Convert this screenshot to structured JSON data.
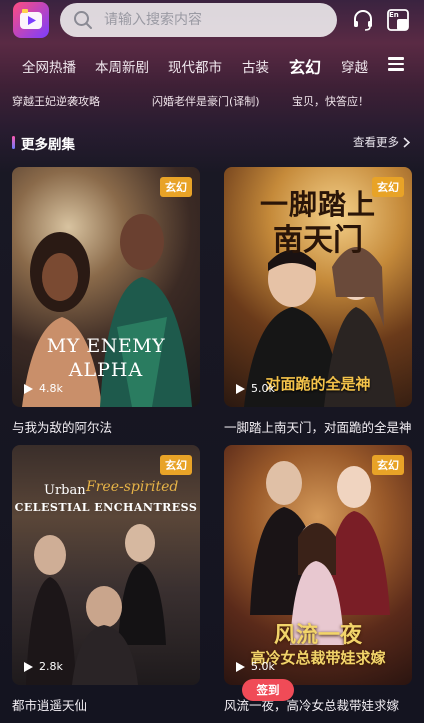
{
  "header": {
    "search_placeholder": "请输入搜索内容",
    "icons": [
      "app-logo-icon",
      "search-icon",
      "headset-icon",
      "translate-icon"
    ],
    "translate_badge": "En"
  },
  "nav": {
    "tabs": [
      {
        "label": "全网热播",
        "active": false
      },
      {
        "label": "本周新剧",
        "active": false
      },
      {
        "label": "现代都市",
        "active": false
      },
      {
        "label": "古装",
        "active": false
      },
      {
        "label": "玄幻",
        "active": true
      },
      {
        "label": "穿越",
        "active": false
      }
    ]
  },
  "ticker": {
    "items": [
      "穿越王妃逆袭攻略",
      "闪婚老伴是豪门(译制)",
      "宝贝，快答应！"
    ]
  },
  "section": {
    "title": "更多剧集",
    "see_more": "查看更多"
  },
  "cards": [
    {
      "title": "与我为敌的阿尔法",
      "tag": "玄幻",
      "views": "4.8k",
      "poster_text": "MY ENEMY",
      "poster_text2": "ALPHA"
    },
    {
      "title": "一脚踏上南天门，对面跪的全是神",
      "tag": "玄幻",
      "views": "5.0k",
      "poster_text": "一脚踏上",
      "poster_text2": "南天门",
      "poster_text3": "对面跪的全是神"
    },
    {
      "title": "都市逍遥天仙",
      "tag": "玄幻",
      "views": "2.8k",
      "poster_text": "Urban",
      "poster_text2": "Free-spirited",
      "poster_text3": "CELESTIAL ENCHANTRESS"
    },
    {
      "title": "风流一夜，高冷女总裁带娃求嫁",
      "tag": "玄幻",
      "views": "5.0k",
      "poster_text": "风流一夜",
      "poster_text2": "高冷女总裁带娃求嫁"
    }
  ],
  "floating_button": {
    "label": "签到"
  },
  "colors": {
    "accent": "#f04b57",
    "tag": "#e8a327",
    "brand_gradient": [
      "#ff4d7e",
      "#7b3dff"
    ]
  }
}
